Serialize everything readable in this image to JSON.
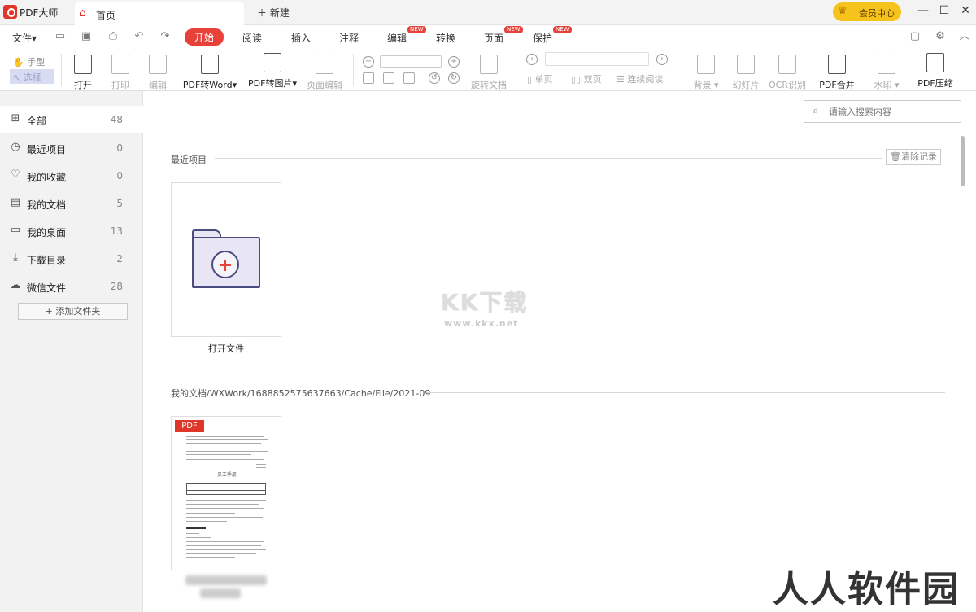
{
  "app": {
    "title": "PDF大师"
  },
  "tabs": {
    "home": "首页",
    "new": "新建"
  },
  "vip": {
    "label": "会员中心"
  },
  "menu": {
    "file": "文件",
    "tabs": [
      {
        "label": "开始"
      },
      {
        "label": "阅读"
      },
      {
        "label": "插入"
      },
      {
        "label": "注释"
      },
      {
        "label": "编辑",
        "badge": "NEW"
      },
      {
        "label": "转换"
      },
      {
        "label": "页面",
        "badge": "NEW"
      },
      {
        "label": "保护",
        "badge": "NEW"
      }
    ]
  },
  "ribbon": {
    "hand": "手型",
    "select": "选择",
    "open": "打开",
    "print": "打印",
    "edit": "编辑",
    "pdf_to_word": "PDF转Word",
    "pdf_to_image": "PDF转图片",
    "page_edit": "页面编辑",
    "rotate_doc": "旋转文档",
    "single_page": "单页",
    "double_page": "双页",
    "continuous": "连续阅读",
    "background": "背景",
    "slideshow": "幻灯片",
    "ocr": "OCR识别",
    "pdf_merge": "PDF合并",
    "watermark": "水印",
    "pdf_compress": "PDF压缩"
  },
  "sidebar": {
    "items": [
      {
        "label": "全部",
        "count": "48",
        "icon": "grid-icon"
      },
      {
        "label": "最近项目",
        "count": "0",
        "icon": "clock-icon"
      },
      {
        "label": "我的收藏",
        "count": "0",
        "icon": "heart-icon"
      },
      {
        "label": "我的文档",
        "count": "5",
        "icon": "document-icon"
      },
      {
        "label": "我的桌面",
        "count": "13",
        "icon": "monitor-icon"
      },
      {
        "label": "下载目录",
        "count": "2",
        "icon": "download-icon"
      },
      {
        "label": "微信文件",
        "count": "28",
        "icon": "wechat-icon"
      }
    ],
    "add_folder": "添加文件夹"
  },
  "main": {
    "search_placeholder": "请输入搜索内容",
    "recent_label": "最近项目",
    "clear_history": "清除记录",
    "open_file": "打开文件",
    "path_label": "我的文档/WXWork/1688852575637663/Cache/File/2021-09",
    "pdf_badge": "PDF",
    "doc_title": "员工手册"
  },
  "watermarks": {
    "kk": "KK下载",
    "kk_url": "www.kkx.net",
    "rr": "人人软件园"
  }
}
